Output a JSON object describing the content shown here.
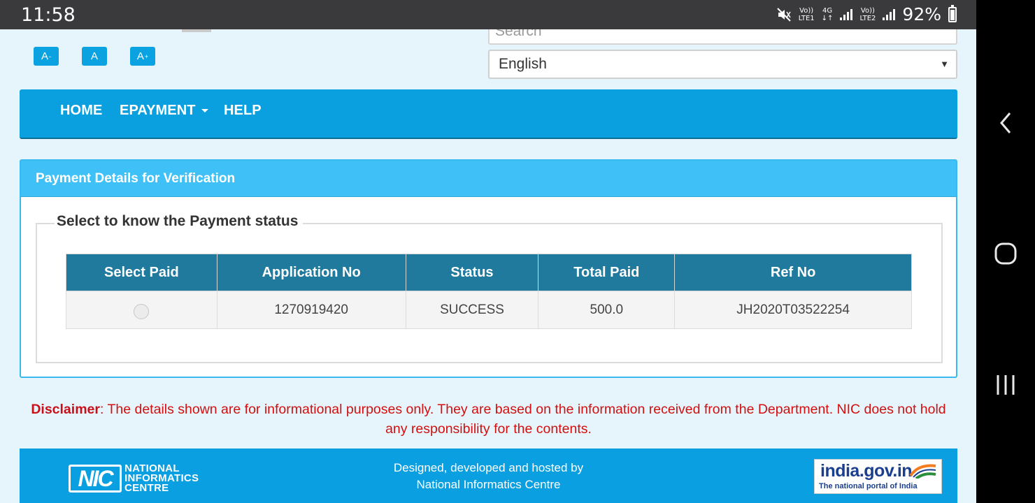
{
  "status_bar": {
    "time": "11:58",
    "sim1_top": "Vo))",
    "sim1_bottom": "LTE1",
    "net_top": "4G",
    "net_bottom": "↓↑",
    "sim2_top": "Vo))",
    "sim2_bottom": "LTE2",
    "battery": "92%"
  },
  "header": {
    "font_buttons": [
      "A",
      "A",
      "A"
    ],
    "font_button_sups": [
      "-",
      "",
      "+"
    ],
    "search_placeholder": "Search",
    "language": "English"
  },
  "menu": {
    "items": [
      "HOME",
      "EPAYMENT",
      "HELP"
    ]
  },
  "panel": {
    "title": "Payment Details for Verification",
    "legend": "Select to know the Payment status",
    "columns": [
      "Select Paid",
      "Application No",
      "Status",
      "Total Paid",
      "Ref No"
    ],
    "rows": [
      {
        "application_no": "1270919420",
        "status": "SUCCESS",
        "total_paid": "500.0",
        "ref_no": "JH2020T03522254"
      }
    ]
  },
  "disclaimer": {
    "label": "Disclaimer",
    "text": ": The details shown are for informational purposes only. They are based on the information received from the Department. NIC does not hold any responsibility for the contents."
  },
  "footer": {
    "line1": "Designed, developed and hosted by",
    "line2": "National Informatics Centre",
    "nic_mark": "NIC",
    "nic_words": [
      "NATIONAL",
      "INFORMATICS",
      "CENTRE"
    ],
    "india_portal": "india.gov.in",
    "india_portal_sub": "The national portal of India"
  },
  "colors": {
    "menu_bg": "#0aa0e0",
    "table_header": "#1f7a9d",
    "panel_head": "#3fc0f7",
    "disclaimer": "#d21010"
  },
  "icons": [
    "mute-icon",
    "signal-icon",
    "battery-icon",
    "back-icon",
    "home-icon",
    "recents-icon",
    "caret-down-icon",
    "radio-icon"
  ]
}
